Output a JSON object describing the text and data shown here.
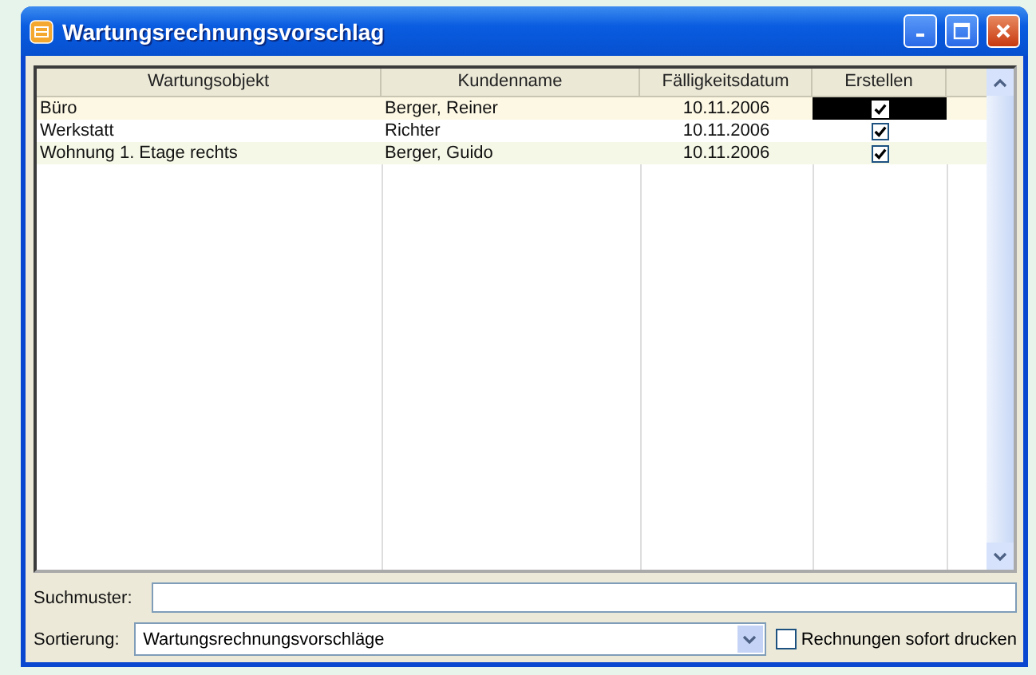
{
  "window": {
    "title": "Wartungsrechnungsvorschlag"
  },
  "table": {
    "columns": [
      "Wartungsobjekt",
      "Kundenname",
      "Fälligkeitsdatum",
      "Erstellen"
    ],
    "rows": [
      {
        "object": "Büro",
        "customer": "Berger, Reiner",
        "due": "10.11.2006",
        "create": true,
        "selected": true
      },
      {
        "object": "Werkstatt",
        "customer": "Richter",
        "due": "10.11.2006",
        "create": true,
        "selected": false
      },
      {
        "object": "Wohnung 1. Etage rechts",
        "customer": "Berger, Guido",
        "due": "10.11.2006",
        "create": true,
        "selected": false
      }
    ]
  },
  "search": {
    "label": "Suchmuster:"
  },
  "sort": {
    "label": "Sortierung:",
    "value": "Wartungsrechnungsvorschläge"
  },
  "print_now": {
    "label": "Rechnungen sofort drucken",
    "checked": false
  }
}
